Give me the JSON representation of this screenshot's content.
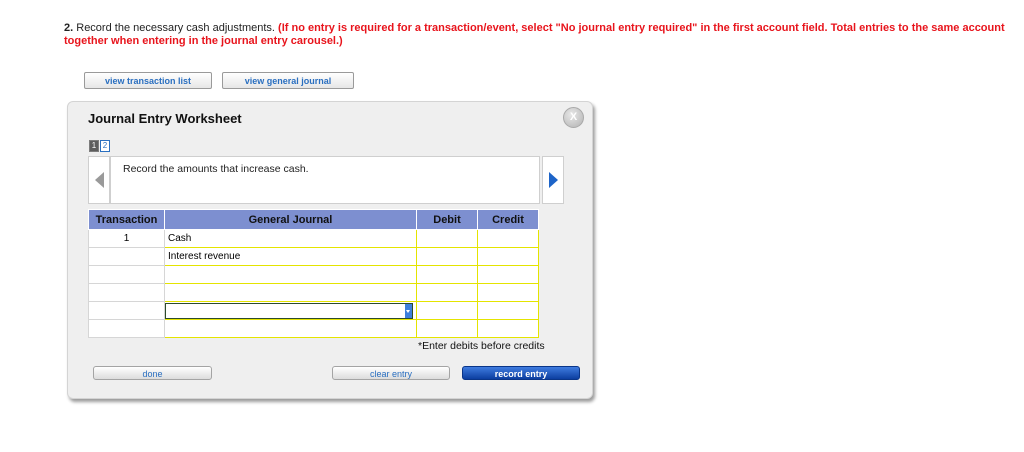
{
  "instructions": {
    "number": "2.",
    "text": "Record the necessary cash adjustments.",
    "note": "(If no entry is required for a transaction/event, select \"No journal entry required\" in the first account field. Total entries to the same account together when entering in the journal entry carousel.)"
  },
  "top_buttons": {
    "transaction_list": "view transaction list",
    "general_journal": "view general journal"
  },
  "worksheet": {
    "title": "Journal Entry Worksheet",
    "close_label": "X",
    "pages": [
      "1",
      "2"
    ],
    "current_page": 1,
    "prompt": "Record the amounts that increase cash."
  },
  "table": {
    "headers": [
      "Transaction",
      "General Journal",
      "Debit",
      "Credit"
    ],
    "rows": [
      {
        "transaction": "1",
        "account": "Cash",
        "debit": "",
        "credit": ""
      },
      {
        "transaction": "",
        "account": "Interest revenue",
        "debit": "",
        "credit": ""
      },
      {
        "transaction": "",
        "account": "",
        "debit": "",
        "credit": ""
      },
      {
        "transaction": "",
        "account": "",
        "debit": "",
        "credit": ""
      },
      {
        "transaction": "",
        "account": "",
        "debit": "",
        "credit": ""
      },
      {
        "transaction": "",
        "account": "",
        "debit": "",
        "credit": ""
      }
    ]
  },
  "footnote": "*Enter debits before credits",
  "bottom_buttons": {
    "done": "done",
    "clear_entry": "clear entry",
    "record_entry": "record entry"
  },
  "colors": {
    "instruction_red": "#e8141c",
    "header_blue": "#7d8fd0",
    "link_blue": "#2a6fc0",
    "primary_button": "#1a4fb5",
    "cell_border_yellow": "#e4e400"
  }
}
